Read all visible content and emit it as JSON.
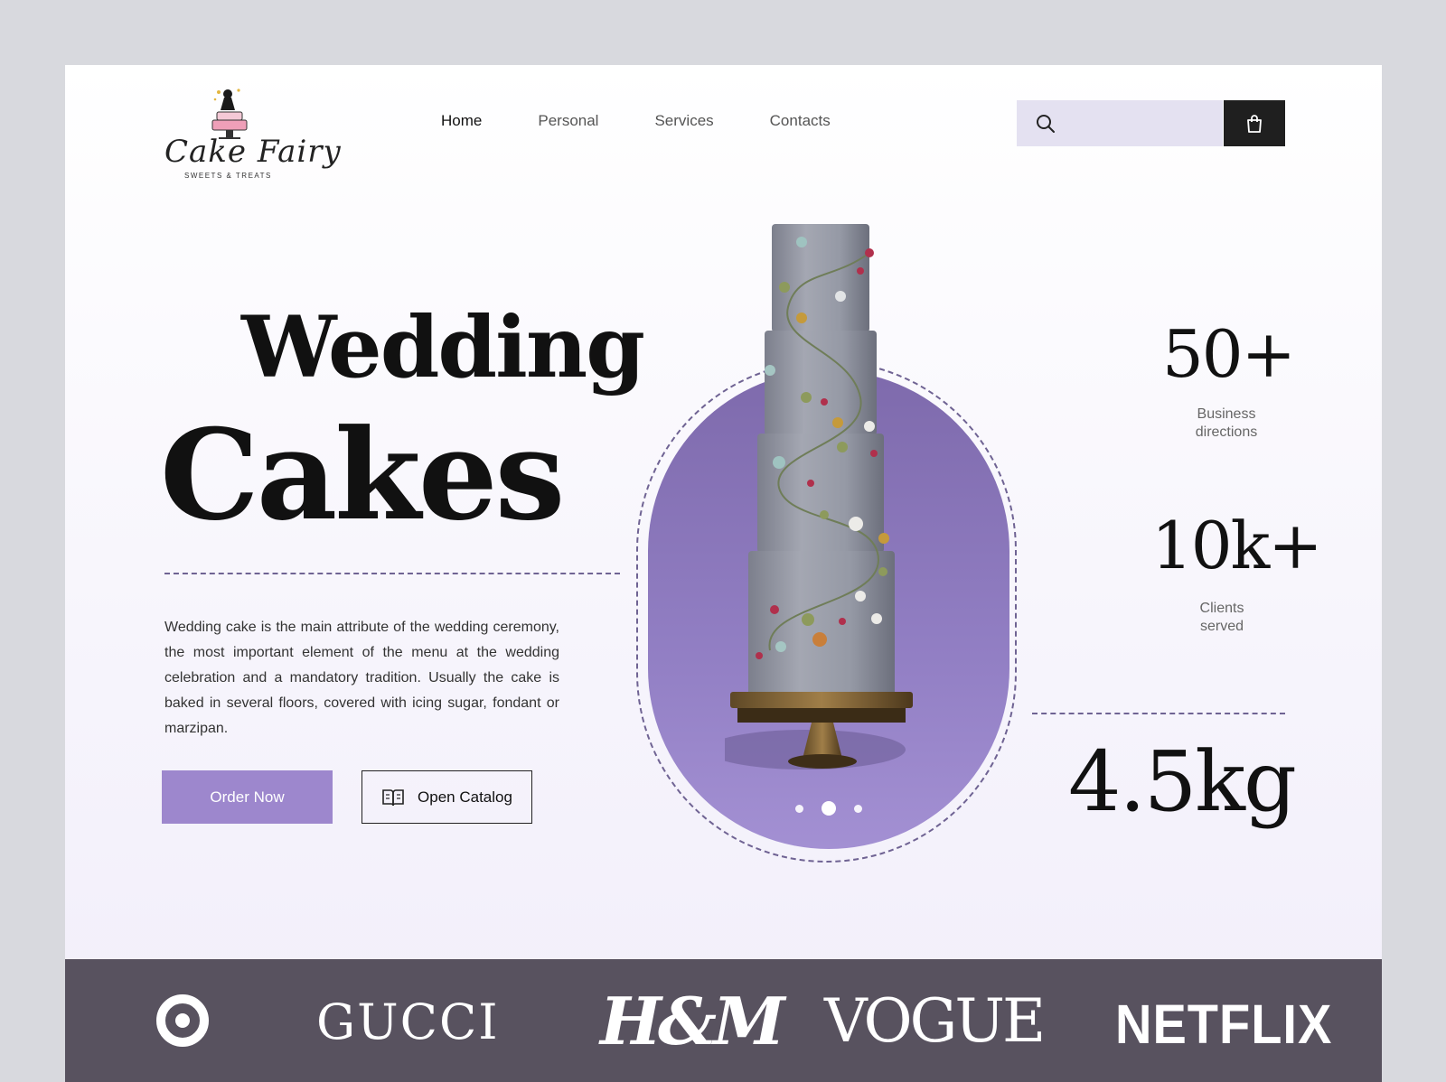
{
  "brand": {
    "logo_script": "Cake Fairy",
    "logo_tagline": "SWEETS & TREATS"
  },
  "nav": {
    "items": [
      {
        "label": "Home",
        "active": true
      },
      {
        "label": "Personal",
        "active": false
      },
      {
        "label": "Services",
        "active": false
      },
      {
        "label": "Contacts",
        "active": false
      }
    ]
  },
  "search": {
    "placeholder": "",
    "icon": "search-icon"
  },
  "cart": {
    "icon": "shopping-bag-icon"
  },
  "hero": {
    "title_line1": "Wedding",
    "title_line2": "Cakes",
    "description": "Wedding cake is the main attribute of the wedding ceremony, the most important element of the menu at the wedding celebration and a mandatory tradition. Usually the cake is baked in several floors, covered with icing sugar, fondant or marzipan.",
    "order_label": "Order Now",
    "catalog_label": "Open Catalog",
    "catalog_icon": "open-book-icon",
    "slider": {
      "count": 3,
      "active": 2
    }
  },
  "stats": [
    {
      "value": "50+",
      "label_line1": "Business",
      "label_line2": "directions"
    },
    {
      "value": "10k+",
      "label_line1": "Clients",
      "label_line2": "served"
    },
    {
      "value": "4.5kg"
    }
  ],
  "partners": {
    "target_icon": "target-logo-icon",
    "gucci": "GUCCI",
    "hm": "H&M",
    "vogue": "VOGUE",
    "netflix": "NETFLIX"
  },
  "colors": {
    "accent": "#9d87cd",
    "arch": "#8673b5",
    "dark": "#1f1f1f",
    "search_bg": "#e4e1f1",
    "brands_bar": "#58525f",
    "outer_bg": "#d8d9de"
  }
}
